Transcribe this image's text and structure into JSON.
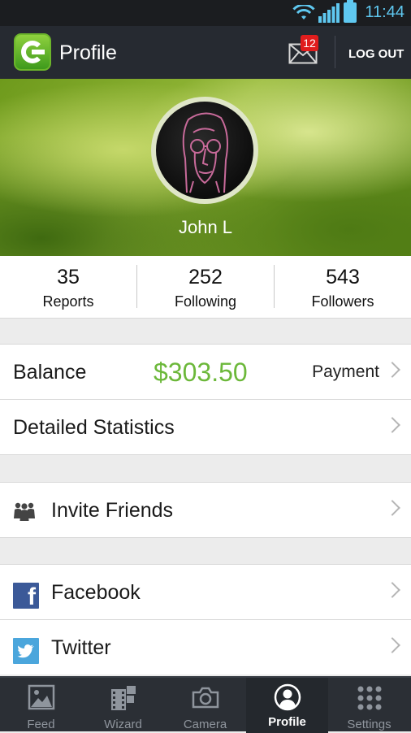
{
  "status_bar": {
    "time": "11:44"
  },
  "action_bar": {
    "title": "Profile",
    "mail_badge": "12",
    "logout_label": "LOG OUT"
  },
  "profile": {
    "name": "John L"
  },
  "stats": [
    {
      "value": "35",
      "label": "Reports"
    },
    {
      "value": "252",
      "label": "Following"
    },
    {
      "value": "543",
      "label": "Followers"
    }
  ],
  "balance": {
    "label": "Balance",
    "amount": "$303.50",
    "action": "Payment"
  },
  "detailed_statistics": {
    "label": "Detailed Statistics"
  },
  "invite": {
    "label": "Invite Friends"
  },
  "social": [
    {
      "label": "Facebook"
    },
    {
      "label": "Twitter"
    }
  ],
  "bottom_nav": [
    {
      "label": "Feed",
      "icon": "image-icon"
    },
    {
      "label": "Wizard",
      "icon": "film-icon"
    },
    {
      "label": "Camera",
      "icon": "camera-icon"
    },
    {
      "label": "Profile",
      "icon": "user-icon",
      "active": true
    },
    {
      "label": "Settings",
      "icon": "grid-icon"
    }
  ],
  "colors": {
    "accent_green": "#6cb83a",
    "badge_red": "#e01d1d",
    "bar_dark": "#262a31",
    "status_blue": "#5fc8f0"
  }
}
